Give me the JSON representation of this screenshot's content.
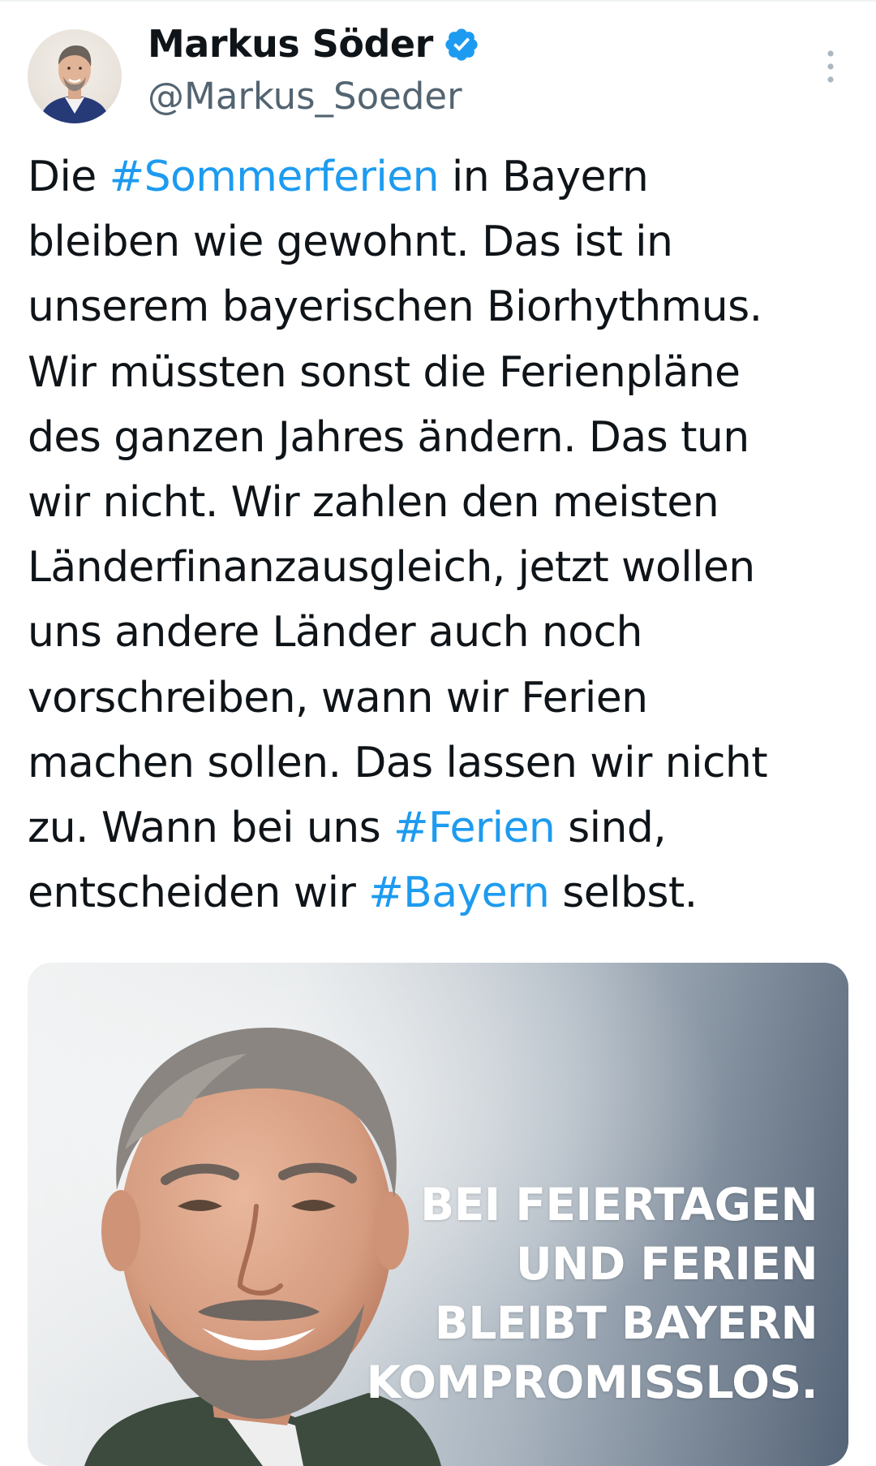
{
  "tweet": {
    "author": {
      "display_name": "Markus Söder",
      "handle": "@Markus_Soeder",
      "verified": true
    },
    "text_segments": [
      {
        "type": "text",
        "value": "Die "
      },
      {
        "type": "hashtag",
        "value": "#Sommerferien"
      },
      {
        "type": "text",
        "value": " in Bayern\nbleiben wie gewohnt. Das ist in\nunserem bayerischen Biorhythmus.\nWir müssten sonst die Ferienpläne\ndes ganzen Jahres ändern. Das tun\nwir nicht. Wir zahlen den meisten\nLänderfinanzausgleich, jetzt wollen\nuns andere Länder auch noch\nvorschreiben, wann wir Ferien\nmachen sollen. Das lassen wir nicht\nzu. Wann bei uns "
      },
      {
        "type": "hashtag",
        "value": "#Ferien"
      },
      {
        "type": "text",
        "value": " sind,\nentscheiden wir "
      },
      {
        "type": "hashtag",
        "value": "#Bayern"
      },
      {
        "type": "text",
        "value": " selbst."
      }
    ],
    "media": {
      "overlay_lines": [
        "BEI FEIERTAGEN",
        "UND FERIEN",
        "BLEIBT BAYERN",
        "KOMPROMISSLOS."
      ]
    }
  },
  "colors": {
    "text": "#0f1419",
    "secondary": "#536471",
    "accent": "#1d9bf0",
    "divider": "#eff3f4"
  },
  "icons": {
    "verified": "verified-badge-icon",
    "more": "more-vertical-icon"
  }
}
